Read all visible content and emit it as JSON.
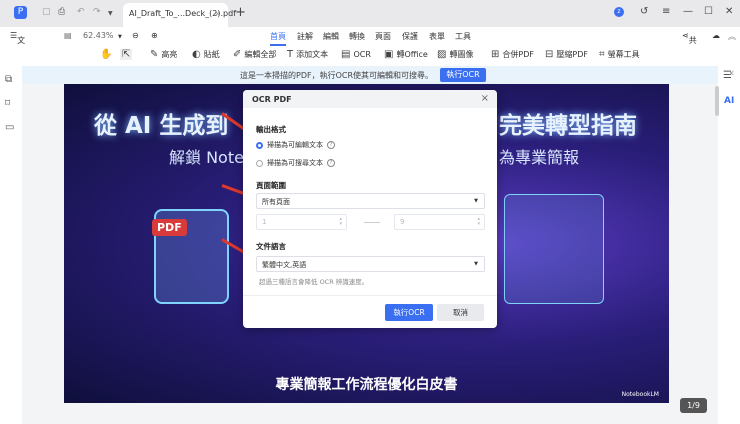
{
  "titlebar": {
    "tab_title": "AI_Draft_To_...Deck_(2).pdf",
    "avatar_letter": "z"
  },
  "menubar": {
    "file": "文件",
    "zoom": "62.43%",
    "nav": [
      "首頁",
      "註解",
      "編輯",
      "轉換",
      "頁面",
      "保護",
      "表單",
      "工具"
    ],
    "share": "共享"
  },
  "toolbar": {
    "items": [
      "高亮",
      "貼紙",
      "編輯全部",
      "添加文本",
      "OCR",
      "轉Office",
      "轉圖像",
      "合併PDF",
      "壓縮PDF",
      "螢幕工具"
    ]
  },
  "banner": {
    "text": "這是一本掃描的PDF，執行OCR使其可編輯和可搜尋。",
    "button": "執行OCR"
  },
  "slide": {
    "title_left": "從 AI 生成到",
    "title_right": "完美轉型指南",
    "subtitle_left": "解鎖 Note",
    "subtitle_right": "為專業簡報",
    "badge": "PDF",
    "footer": "專業簡報工作流程優化白皮書",
    "brand": "NotebookLM"
  },
  "pager": "1/9",
  "dialog": {
    "title": "OCR PDF",
    "output_label": "輸出格式",
    "option1": "掃描為可編輯文本",
    "option2": "掃描為可搜尋文本",
    "range_label": "頁面範圍",
    "range_value": "所有頁面",
    "from": "1",
    "to": "9",
    "lang_label": "文件語言",
    "lang_value": "繁體中文,英語",
    "hint": "超過三種語言會降低 OCR 辨識速度。",
    "ok": "執行OCR",
    "cancel": "取消"
  },
  "colors": {
    "accent": "#3a6ff2",
    "arrow": "#e0382b"
  }
}
